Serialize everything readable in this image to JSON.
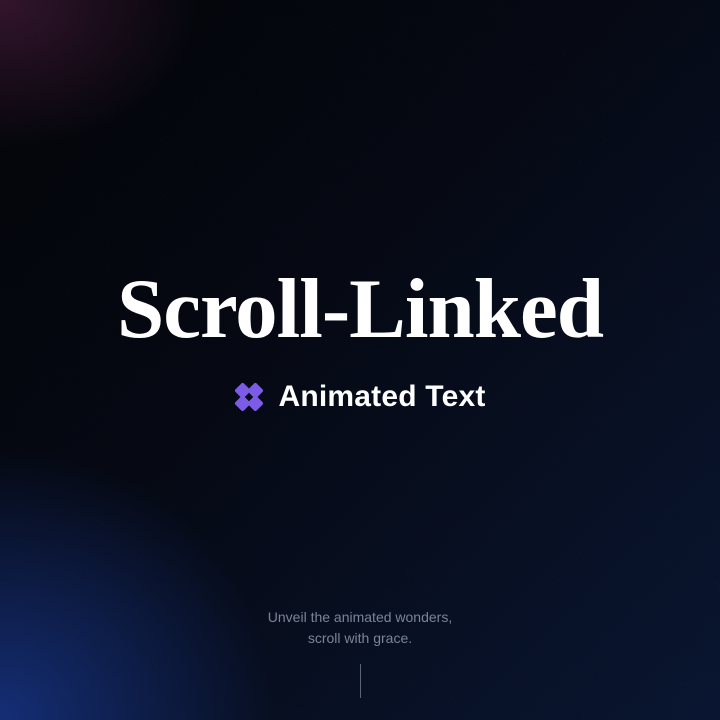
{
  "hero": {
    "title": "Scroll-Linked",
    "subtitle": "Animated Text"
  },
  "footer": {
    "hint_line1": "Unveil the animated wonders,",
    "hint_line2": "scroll with grace."
  },
  "colors": {
    "accent": "#7C5CE6",
    "text": "#ffffff",
    "muted": "#7a8599"
  }
}
